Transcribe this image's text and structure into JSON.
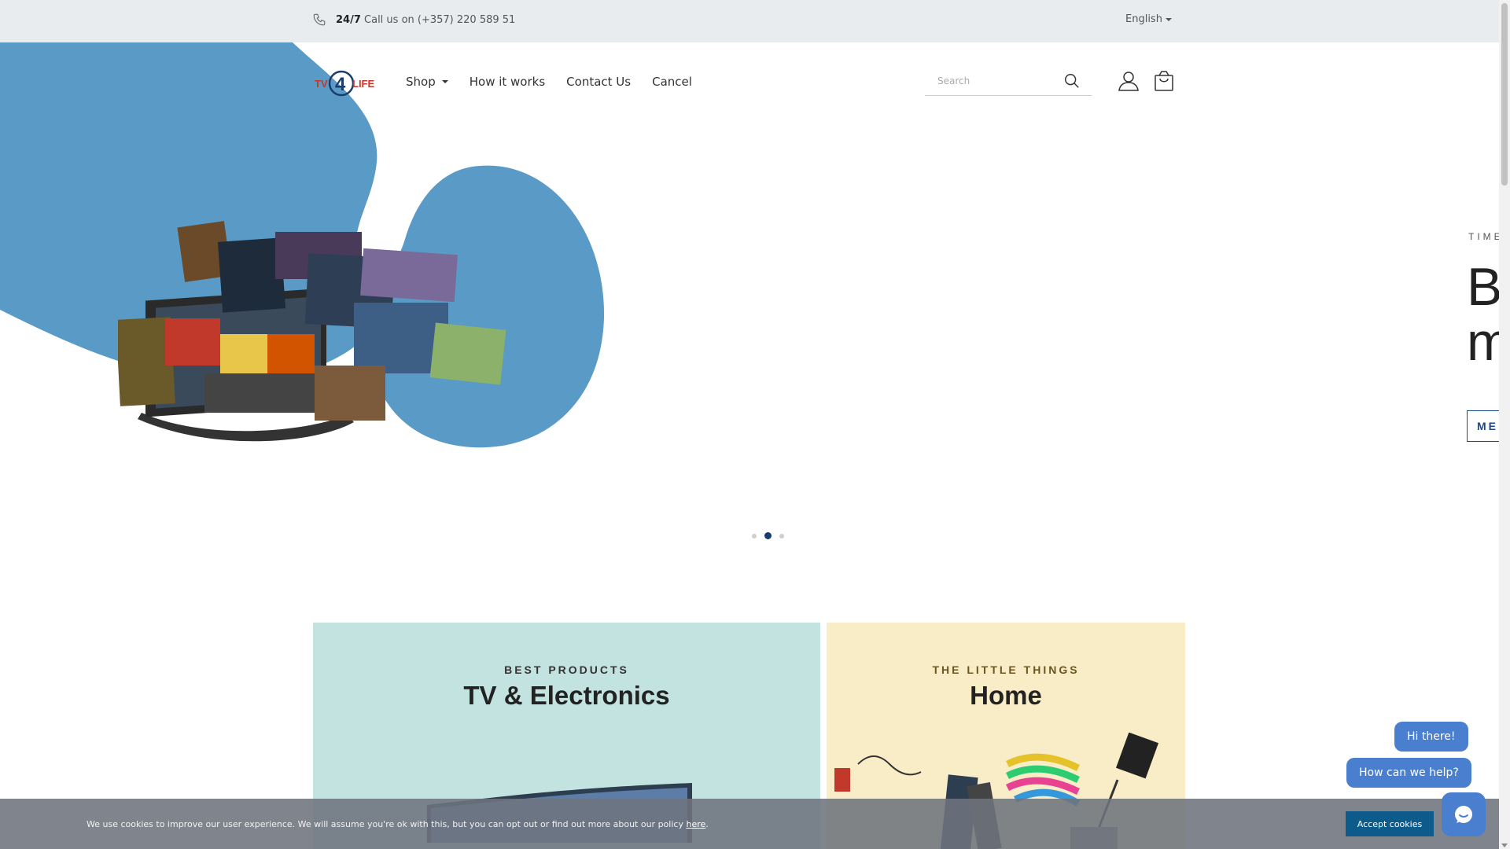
{
  "topbar": {
    "phone_icon": "phone-icon",
    "hours": "24/7",
    "call_text": "Call us on (+357) 220 589 51",
    "language": "English"
  },
  "header": {
    "logo_text": "TV4LIFE",
    "nav": [
      {
        "label": "Shop",
        "has_dropdown": true
      },
      {
        "label": "How it works"
      },
      {
        "label": "Contact Us"
      },
      {
        "label": "Cancel"
      }
    ],
    "search_placeholder": "Search",
    "icons": [
      "search-icon",
      "user-icon",
      "cart-icon"
    ]
  },
  "hero": {
    "slides": 3,
    "active_slide": 2,
    "next_slide": {
      "kicker": "TIME",
      "heading_line1": "B",
      "heading_line2": "m",
      "button": "ME"
    }
  },
  "categories": [
    {
      "kicker": "BEST PRODUCTS",
      "title": "TV & Electronics"
    },
    {
      "kicker": "THE LITTLE THINGS",
      "title": "Home"
    }
  ],
  "cookie": {
    "message": "We use cookies to improve our user experience. We will assume you're ok with this, but you can opt out or find out more about our policy",
    "link": "here",
    "accept": "Accept cookies"
  },
  "chat": {
    "bubble1": "Hi there!",
    "bubble2": "How can we help?",
    "icon": "chat-icon"
  },
  "colors": {
    "brand_blue": "#5a9ac6",
    "tile_tv": "#c3e3e1",
    "tile_home": "#f8edc6",
    "chat": "#4a7fcf",
    "accept": "#0c5b8a"
  }
}
